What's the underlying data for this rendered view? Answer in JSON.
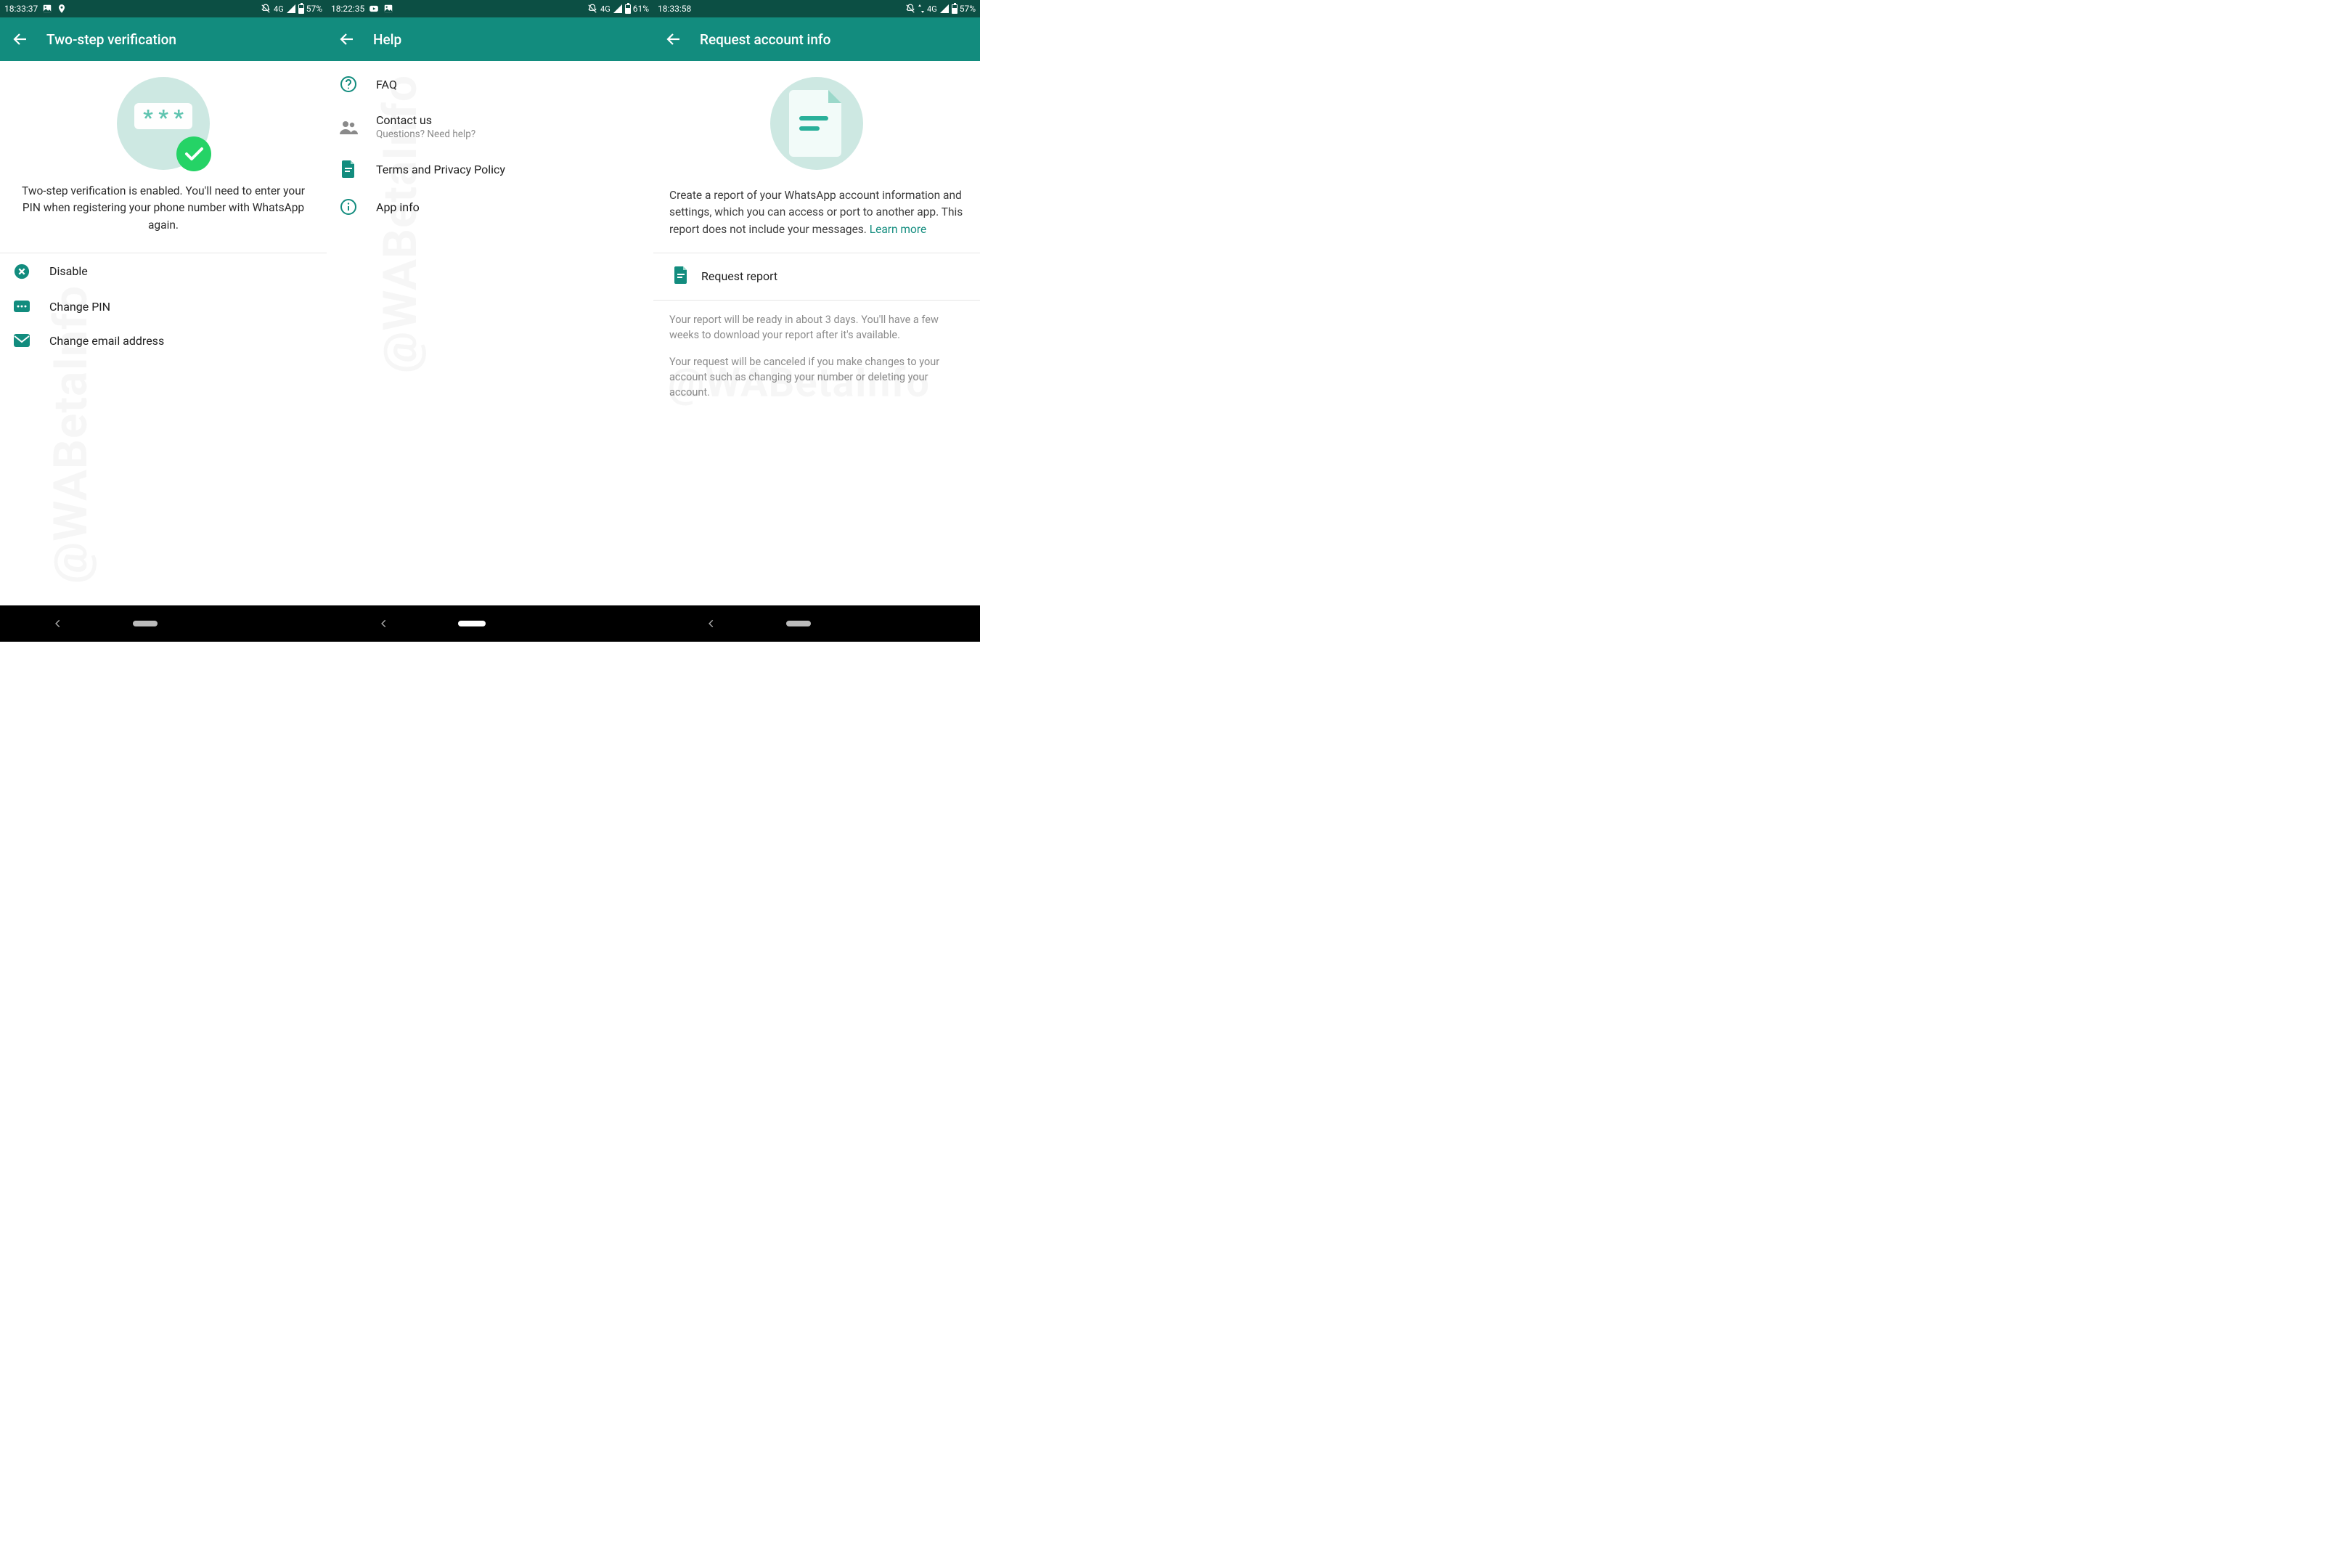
{
  "colors": {
    "brand": "#128c7e",
    "statusBg": "#0c4f44",
    "heroBg": "#cde8e2",
    "muted": "#8a8a8a"
  },
  "screens": [
    {
      "status": {
        "time": "18:33:37",
        "network": "4G",
        "battery_pct": "57%"
      },
      "title": "Two-step verification",
      "hero_text": "Two-step verification is enabled. You'll need to enter your PIN when registering your phone number with WhatsApp again.",
      "options": [
        {
          "icon": "x-circle",
          "label": "Disable"
        },
        {
          "icon": "dots-box",
          "label": "Change PIN"
        },
        {
          "icon": "mail",
          "label": "Change email address"
        }
      ]
    },
    {
      "status": {
        "time": "18:22:35",
        "network": "4G",
        "battery_pct": "61%"
      },
      "title": "Help",
      "items": [
        {
          "icon": "help-circle",
          "label": "FAQ"
        },
        {
          "icon": "people",
          "label": "Contact us",
          "sub": "Questions? Need help?"
        },
        {
          "icon": "doc",
          "label": "Terms and Privacy Policy"
        },
        {
          "icon": "info-circle",
          "label": "App info"
        }
      ]
    },
    {
      "status": {
        "time": "18:33:58",
        "network": "4G",
        "battery_pct": "57%"
      },
      "title": "Request account info",
      "body_text": "Create a report of your WhatsApp account information and settings, which you can access or port to another app. This report does not include your messages. ",
      "learn_more": "Learn more",
      "request_label": "Request report",
      "note1": "Your report will be ready in about 3 days. You'll have a few weeks to download your report after it's available.",
      "note2": "Your request will be canceled if you make changes to your account such as changing your number or deleting your account."
    }
  ],
  "watermark": "@WABetaInfo"
}
